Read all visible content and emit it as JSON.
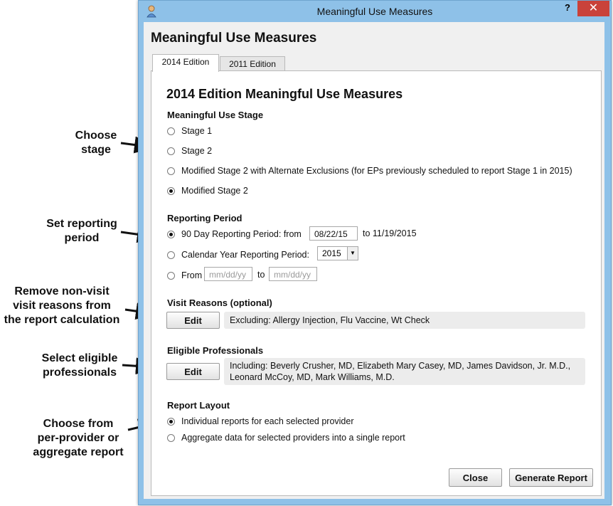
{
  "annotations": {
    "choose_stage": [
      "Choose",
      "stage"
    ],
    "set_period": [
      "Set reporting",
      "period"
    ],
    "remove_reasons": [
      "Remove non-visit",
      "visit reasons from",
      "the report calculation"
    ],
    "select_professionals": [
      "Select eligible",
      "professionals"
    ],
    "choose_report": [
      "Choose from",
      "per-provider or",
      "aggregate report"
    ]
  },
  "window": {
    "title": "Meaningful Use Measures",
    "help": "?",
    "close": "✕"
  },
  "dialog": {
    "heading": "Meaningful Use Measures"
  },
  "tabs": [
    {
      "label": "2014 Edition",
      "selected": true
    },
    {
      "label": "2011 Edition",
      "selected": false
    }
  ],
  "panel": {
    "title": "2014 Edition Meaningful Use Measures",
    "stage": {
      "heading": "Meaningful Use Stage",
      "options": [
        {
          "label": "Stage 1",
          "selected": false
        },
        {
          "label": "Stage 2",
          "selected": false
        },
        {
          "label": "Modified Stage 2 with Alternate Exclusions (for EPs previously scheduled to report Stage 1 in 2015)",
          "selected": false
        },
        {
          "label": "Modified Stage 2",
          "selected": true
        }
      ]
    },
    "period": {
      "heading": "Reporting Period",
      "ninety_day": {
        "label": "90 Day Reporting Period:  from",
        "from": "08/22/15",
        "to_text": "to 11/19/2015",
        "selected": true
      },
      "calendar": {
        "label": "Calendar Year Reporting Period:",
        "year": "2015",
        "selected": false
      },
      "custom": {
        "label": "From",
        "from_placeholder": "mm/dd/yy",
        "to_label": "to",
        "to_placeholder": "mm/dd/yy",
        "selected": false
      }
    },
    "visit_reasons": {
      "heading": "Visit Reasons (optional)",
      "edit": "Edit",
      "summary": "Excluding: Allergy Injection, Flu Vaccine, Wt Check"
    },
    "professionals": {
      "heading": "Eligible Professionals",
      "edit": "Edit",
      "summary_line1": "Including: Beverly Crusher, MD, Elizabeth Mary Casey, MD, James Davidson, Jr. M.D.,",
      "summary_line2": "Leonard McCoy, MD, Mark Williams, M.D."
    },
    "layout": {
      "heading": "Report Layout",
      "options": [
        {
          "label": "Individual reports for each selected provider",
          "selected": true
        },
        {
          "label": "Aggregate data for selected providers into a single report",
          "selected": false
        }
      ]
    }
  },
  "footer": {
    "close": "Close",
    "generate": "Generate Report"
  }
}
